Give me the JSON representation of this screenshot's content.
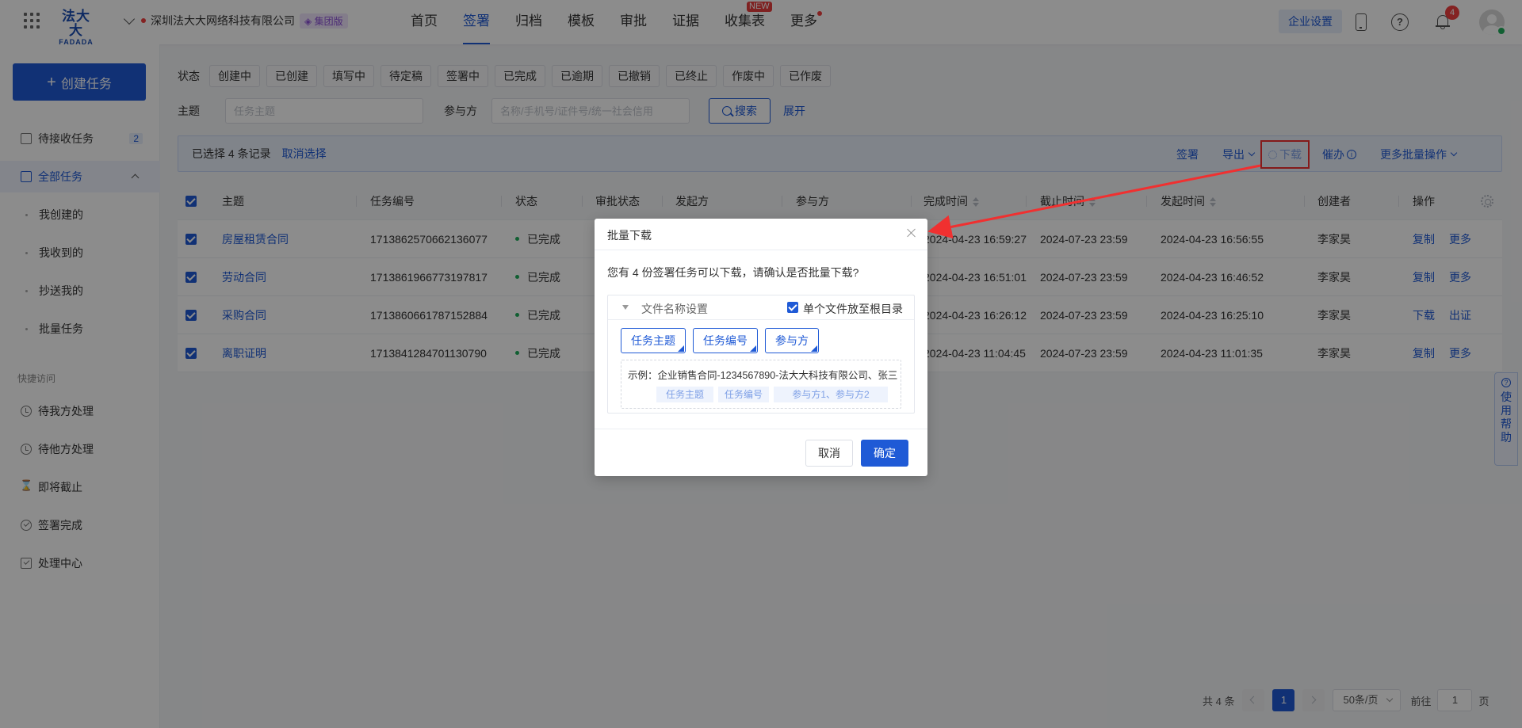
{
  "header": {
    "logo_top": "法大大",
    "logo_bottom": "FADADA",
    "company": "深圳法大大网络科技有限公司",
    "edition_badge": "集团版",
    "nav": [
      "首页",
      "签署",
      "归档",
      "模板",
      "审批",
      "证据",
      "收集表",
      "更多"
    ],
    "nav_active_index": 1,
    "new_tag": "NEW",
    "enterprise_settings": "企业设置",
    "notification_count": "4"
  },
  "sidebar": {
    "create_button": "创建任务",
    "pending_receive": "待接收任务",
    "pending_receive_count": "2",
    "all_tasks": "全部任务",
    "sub_items": [
      "我创建的",
      "我收到的",
      "抄送我的",
      "批量任务"
    ],
    "quick_access_title": "快捷访问",
    "quick_items": [
      "待我方处理",
      "待他方处理",
      "即将截止",
      "签署完成",
      "处理中心"
    ]
  },
  "filters": {
    "status_label": "状态",
    "status_tags": [
      "创建中",
      "已创建",
      "填写中",
      "待定稿",
      "签署中",
      "已完成",
      "已逾期",
      "已撤销",
      "已终止",
      "作废中",
      "已作废"
    ],
    "subject_label": "主题",
    "subject_placeholder": "任务主题",
    "participant_label": "参与方",
    "participant_placeholder": "名称/手机号/证件号/统一社会信用",
    "search_button": "搜索",
    "expand": "展开"
  },
  "selection_bar": {
    "selected_text": "已选择 4 条记录",
    "cancel": "取消选择",
    "actions": {
      "sign": "签署",
      "export": "导出",
      "download": "下载",
      "remind": "催办",
      "more": "更多批量操作"
    }
  },
  "table": {
    "columns": [
      "主题",
      "任务编号",
      "状态",
      "审批状态",
      "发起方",
      "参与方",
      "完成时间",
      "截止时间",
      "发起时间",
      "创建者",
      "操作"
    ],
    "rows": [
      {
        "subject": "房屋租赁合同",
        "id": "1713862570662136077",
        "status": "已完成",
        "completed": "2024-04-23 16:59:27",
        "deadline": "2024-07-23 23:59",
        "initiated": "2024-04-23 16:56:55",
        "creator": "李家昊",
        "op1": "复制",
        "op2": "更多"
      },
      {
        "subject": "劳动合同",
        "id": "1713861966773197817",
        "status": "已完成",
        "completed": "2024-04-23 16:51:01",
        "deadline": "2024-07-23 23:59",
        "initiated": "2024-04-23 16:46:52",
        "creator": "李家昊",
        "op1": "复制",
        "op2": "更多"
      },
      {
        "subject": "采购合同",
        "id": "1713860661787152884",
        "status": "已完成",
        "completed": "2024-04-23 16:26:12",
        "deadline": "2024-07-23 23:59",
        "initiated": "2024-04-23 16:25:10",
        "creator": "李家昊",
        "op1": "下载",
        "op2": "出证"
      },
      {
        "subject": "离职证明",
        "id": "1713841284701130790",
        "status": "已完成",
        "completed": "2024-04-23 11:04:45",
        "deadline": "2024-07-23 23:59",
        "initiated": "2024-04-23 11:01:35",
        "creator": "李家昊",
        "op1": "复制",
        "op2": "更多"
      }
    ]
  },
  "help_tab": [
    "使",
    "用",
    "帮",
    "助"
  ],
  "pagination": {
    "total": "共 4 条",
    "current": "1",
    "page_size": "50条/页",
    "goto_label": "前往",
    "goto_value": "1",
    "unit": "页"
  },
  "modal": {
    "title": "批量下载",
    "message": "您有 4 份签署任务可以下载，请确认是否批量下载?",
    "section_title": "文件名称设置",
    "root_option": "单个文件放至根目录",
    "tokens": [
      "任务主题",
      "任务编号",
      "参与方"
    ],
    "example_text": "示例：企业销售合同-1234567890-法大大科技有限公司、张三",
    "example_tags": [
      "任务主题",
      "任务编号",
      "参与方1、参与方2"
    ],
    "cancel": "取消",
    "confirm": "确定"
  },
  "colors": {
    "primary": "#1f5ad6",
    "annotation_red": "#f03030",
    "status_done": "#1fae5b"
  }
}
